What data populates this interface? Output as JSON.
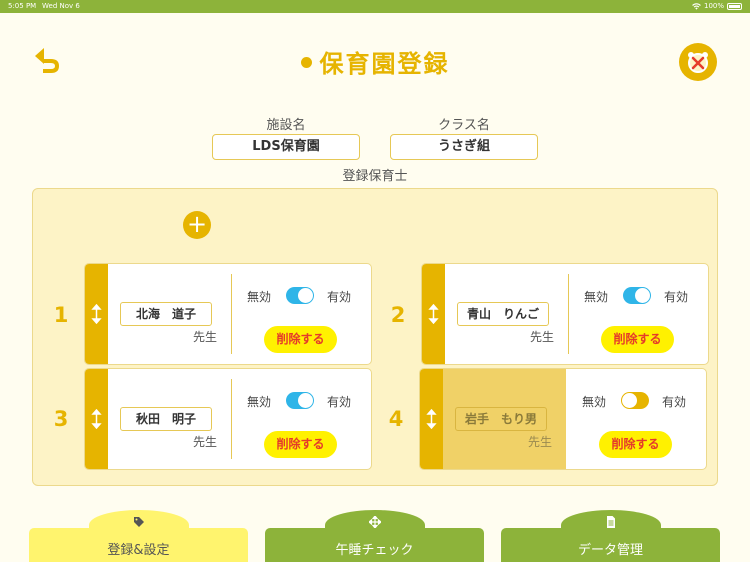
{
  "status_bar": {
    "time": "5:05 PM",
    "date": "Wed Nov 6",
    "battery": "100%"
  },
  "header": {
    "title": "保育園登録"
  },
  "form": {
    "facility_label": "施設名",
    "facility_value": "LDS保育園",
    "class_label": "クラス名",
    "class_value": "うさぎ組",
    "caregivers_label": "登録保育士"
  },
  "add_button": {
    "label": "+"
  },
  "caregivers": [
    {
      "number": "1",
      "name": "北海　道子",
      "suffix": "先生",
      "off_label": "無効",
      "on_label": "有効",
      "enabled": true,
      "delete_label": "削除する"
    },
    {
      "number": "2",
      "name": "青山　りんご",
      "suffix": "先生",
      "off_label": "無効",
      "on_label": "有効",
      "enabled": true,
      "delete_label": "削除する"
    },
    {
      "number": "3",
      "name": "秋田　明子",
      "suffix": "先生",
      "off_label": "無効",
      "on_label": "有効",
      "enabled": true,
      "delete_label": "削除する"
    },
    {
      "number": "4",
      "name": "岩手　もり男",
      "suffix": "先生",
      "off_label": "無効",
      "on_label": "有効",
      "enabled": false,
      "delete_label": "削除する"
    }
  ],
  "tabs": [
    {
      "label": "登録&設定",
      "icon": "tag-icon",
      "active": true
    },
    {
      "label": "午睡チェック",
      "icon": "move-arrows-icon",
      "active": false
    },
    {
      "label": "データ管理",
      "icon": "document-icon",
      "active": false
    }
  ],
  "colors": {
    "accent": "#e6b400",
    "green": "#8db33a",
    "toggle_on": "#2fb5e8",
    "delete_bg": "#fff100",
    "delete_text": "#e53b2a"
  }
}
